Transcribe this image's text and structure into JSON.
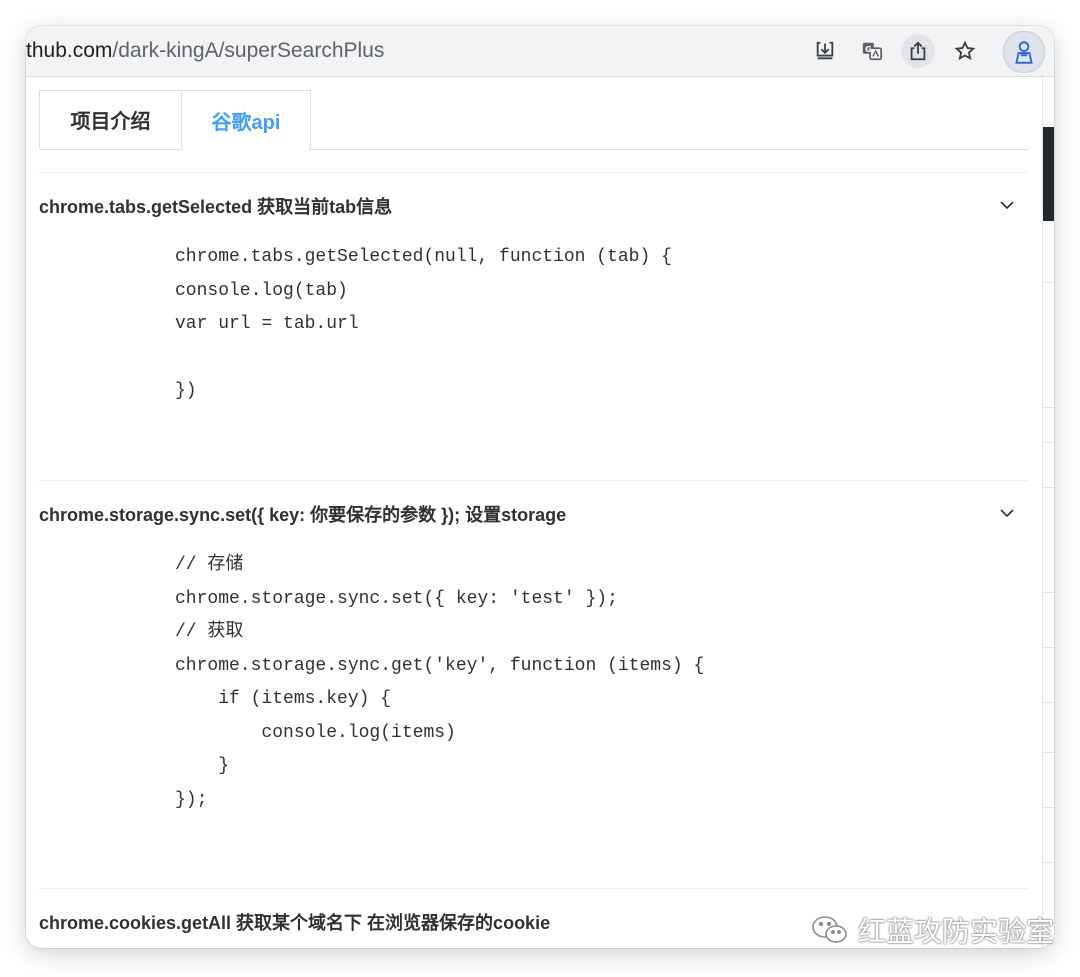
{
  "browser": {
    "url_domain": "thub.com",
    "url_path": "/dark-kingA/superSearchPlus"
  },
  "icons": {
    "download": "download-icon",
    "translate": "translate-icon",
    "share": "share-icon",
    "bookmark": "star-icon",
    "extension": "extension-icon"
  },
  "tabs": [
    {
      "label": "项目介绍",
      "active": false
    },
    {
      "label": "谷歌api",
      "active": true
    }
  ],
  "sections": [
    {
      "title": "chrome.tabs.getSelected 获取当前tab信息",
      "code": "chrome.tabs.getSelected(null, function (tab) {\nconsole.log(tab)\nvar url = tab.url\n\n})"
    },
    {
      "title": "chrome.storage.sync.set({ key: 你要保存的参数 }); 设置storage",
      "code": "// 存储\nchrome.storage.sync.set({ key: 'test' });\n// 获取\nchrome.storage.sync.get('key', function (items) {\n    if (items.key) {\n        console.log(items)\n    }\n});"
    },
    {
      "title": "chrome.cookies.getAll 获取某个域名下 在浏览器保存的cookie"
    }
  ],
  "watermark": "红蓝攻防实验室",
  "colors": {
    "accent": "#409eff",
    "text": "#303133",
    "border": "#dcdfe6"
  }
}
